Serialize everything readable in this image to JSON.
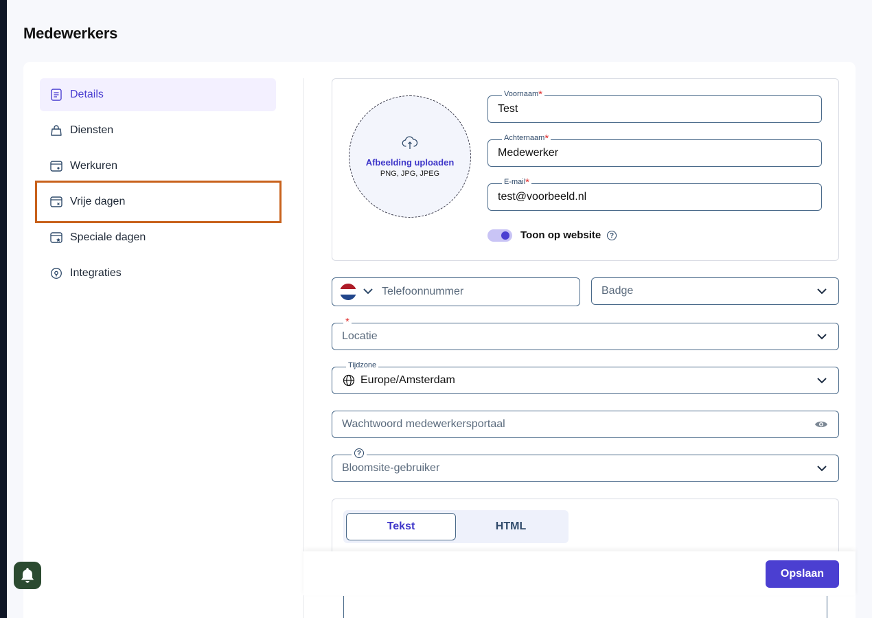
{
  "page": {
    "title": "Medewerkers"
  },
  "sidebar": {
    "items": [
      {
        "label": "Details",
        "icon": "document-icon",
        "active": true
      },
      {
        "label": "Diensten",
        "icon": "bag-icon"
      },
      {
        "label": "Werkuren",
        "icon": "calendar-clock-icon"
      },
      {
        "label": "Vrije dagen",
        "icon": "calendar-x-icon"
      },
      {
        "label": "Speciale dagen",
        "icon": "calendar-star-icon"
      },
      {
        "label": "Integraties",
        "icon": "integration-icon"
      }
    ]
  },
  "upload": {
    "title": "Afbeelding uploaden",
    "formats": "PNG, JPG, JPEG"
  },
  "form": {
    "voornaam": {
      "label": "Voornaam",
      "value": "Test",
      "required_mark": "*"
    },
    "achternaam": {
      "label": "Achternaam",
      "value": "Medewerker",
      "required_mark": "*"
    },
    "email": {
      "label": "E-mail",
      "value": "test@voorbeeld.nl",
      "required_mark": "*"
    },
    "toon_op_website": {
      "label": "Toon op website",
      "checked": true
    },
    "telefoon": {
      "placeholder": "Telefoonnummer"
    },
    "badge": {
      "placeholder": "Badge"
    },
    "locatie": {
      "placeholder": "Locatie",
      "required_mark": "*"
    },
    "tijdzone": {
      "label": "Tijdzone",
      "value": "Europe/Amsterdam"
    },
    "wachtwoord": {
      "placeholder": "Wachtwoord medewerkersportaal"
    },
    "bloomsite": {
      "placeholder": "Bloomsite-gebruiker",
      "help": "?"
    }
  },
  "editor": {
    "tabs": [
      "Tekst",
      "HTML"
    ],
    "active_tab": "Tekst"
  },
  "actions": {
    "save_label": "Opslaan"
  },
  "help_glyph": "?",
  "colors": {
    "accent": "#4b3fd1",
    "highlight": "#c8611b",
    "border": "#4a6a8a"
  }
}
